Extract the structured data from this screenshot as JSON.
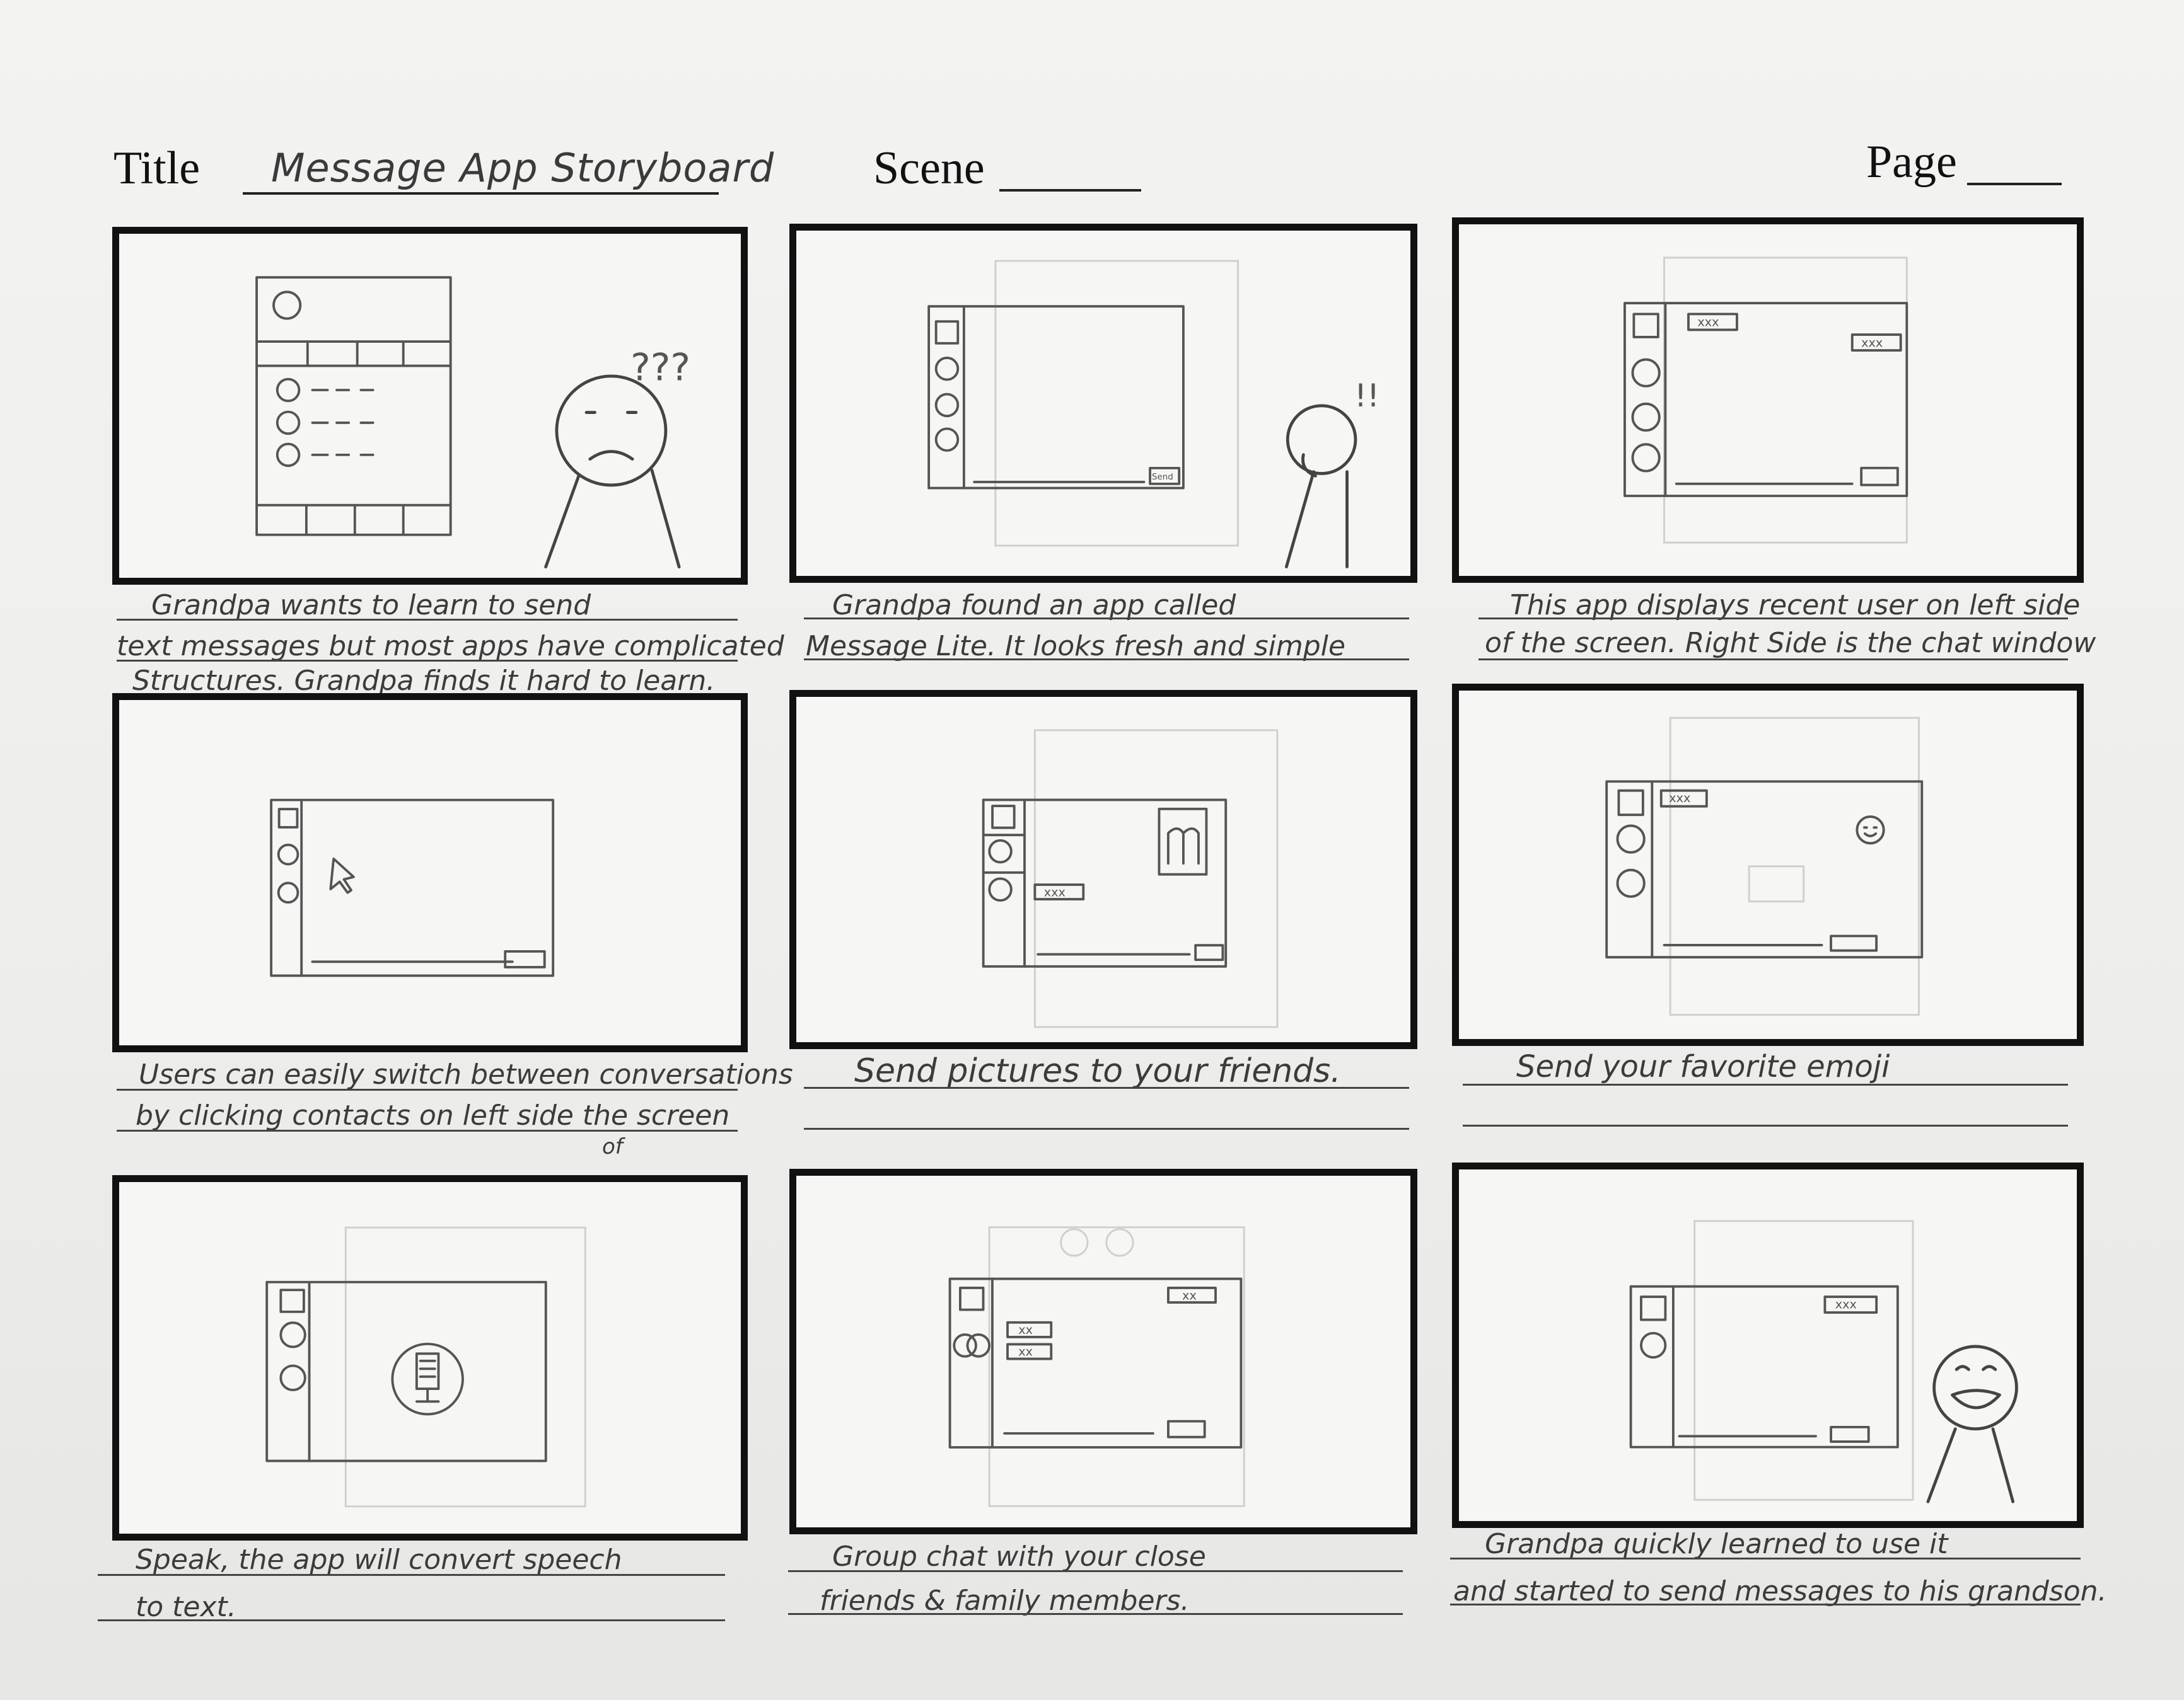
{
  "header": {
    "title_label": "Title",
    "title_value": "Message App Storyboard",
    "scene_label": "Scene",
    "page_label": "Page"
  },
  "panels": [
    {
      "caption_lines": [
        "Grandpa wants to learn to send",
        "text messages but most apps have complicated",
        "Structures. Grandpa finds it hard to learn."
      ],
      "sketch_marks": [
        "???"
      ]
    },
    {
      "caption_lines": [
        "Grandpa found an app called",
        "Message Lite. It looks fresh and simple"
      ],
      "sketch_marks": [
        "!!",
        "Send"
      ]
    },
    {
      "caption_lines": [
        "This app displays recent user on left side",
        "of the screen. Right Side is the chat window"
      ],
      "sketch_marks": [
        "xxx",
        "xxx"
      ]
    },
    {
      "caption_lines": [
        "Users can easily switch between conversations",
        "by clicking contacts on left side the screen",
        "of"
      ],
      "sketch_marks": []
    },
    {
      "caption_lines": [
        "Send pictures to your friends."
      ],
      "sketch_marks": [
        "xxx"
      ]
    },
    {
      "caption_lines": [
        "Send your favorite emoji"
      ],
      "sketch_marks": [
        "xxx"
      ]
    },
    {
      "caption_lines": [
        "Speak, the app will convert speech",
        "to text."
      ],
      "sketch_marks": []
    },
    {
      "caption_lines": [
        "Group chat with your close",
        "friends & family members."
      ],
      "sketch_marks": [
        "xx",
        "xx",
        "xx"
      ]
    },
    {
      "caption_lines": [
        "Grandpa quickly learned to use it",
        "and started to send messages to his grandson."
      ],
      "sketch_marks": [
        "xxx"
      ]
    }
  ]
}
